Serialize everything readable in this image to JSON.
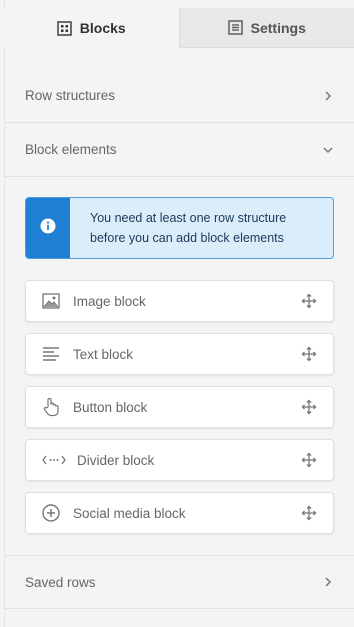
{
  "tabs": [
    {
      "label": "Blocks",
      "icon": "grid-icon",
      "active": true
    },
    {
      "label": "Settings",
      "icon": "list-icon",
      "active": false
    }
  ],
  "accordion": {
    "row_structures": {
      "label": "Row structures",
      "state": "collapsed"
    },
    "block_elements": {
      "label": "Block elements",
      "state": "expanded"
    },
    "saved_rows": {
      "label": "Saved rows",
      "state": "collapsed"
    }
  },
  "info": {
    "line1": "You need at least one row structure",
    "line2": "before you can add block elements",
    "icon": "info-icon"
  },
  "blocks": [
    {
      "label": "Image block",
      "icon": "image-icon"
    },
    {
      "label": "Text block",
      "icon": "text-icon"
    },
    {
      "label": "Button block",
      "icon": "pointer-icon"
    },
    {
      "label": "Divider block",
      "icon": "divider-icon"
    },
    {
      "label": "Social media block",
      "icon": "plus-circle-icon"
    }
  ],
  "colors": {
    "info_bg": "#dbedfb",
    "info_accent": "#1e7fd3",
    "panel_bg": "#f4f4f4"
  }
}
